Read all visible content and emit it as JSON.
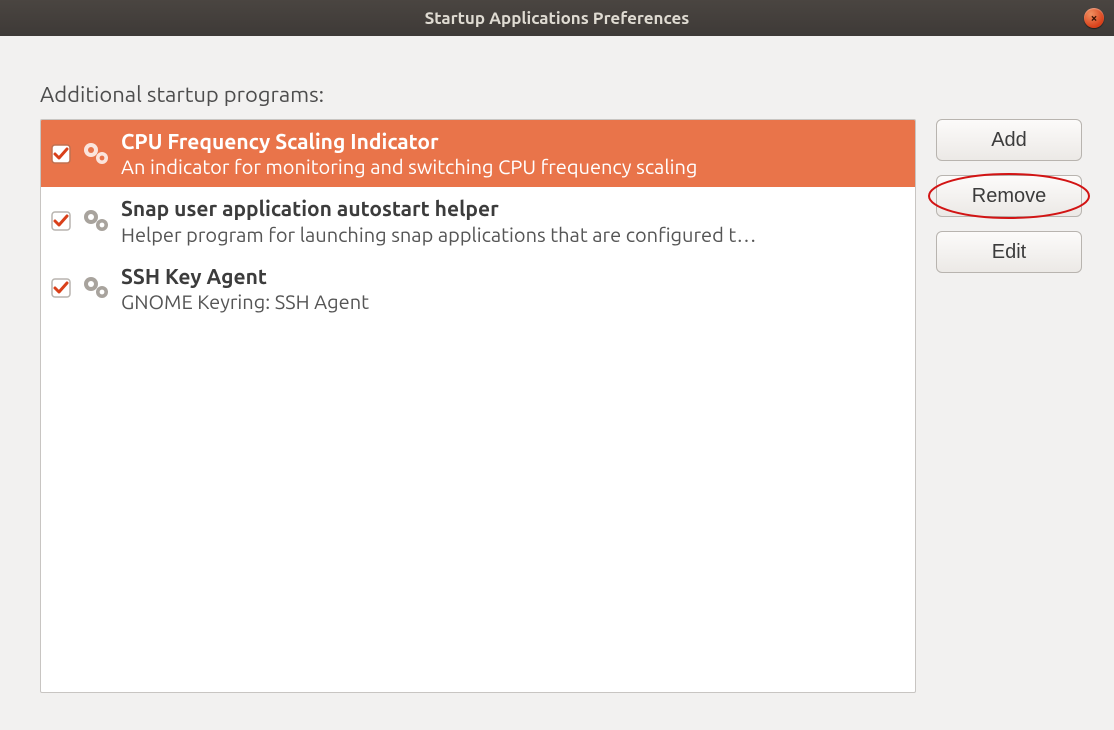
{
  "window": {
    "title": "Startup Applications Preferences"
  },
  "section_label": "Additional startup programs:",
  "buttons": {
    "add": "Add",
    "remove": "Remove",
    "edit": "Edit"
  },
  "colors": {
    "selection": "#e9744a",
    "titlebar": "#3e3a37",
    "close": "#d9401a"
  },
  "annotation": {
    "circled_button": "remove"
  },
  "items": [
    {
      "name": "CPU Frequency Scaling Indicator",
      "desc": "An indicator for monitoring and switching CPU frequency scaling",
      "checked": true,
      "selected": true
    },
    {
      "name": "Snap user application autostart helper",
      "desc": "Helper program for launching snap applications that are configured t…",
      "checked": true,
      "selected": false
    },
    {
      "name": "SSH Key Agent",
      "desc": "GNOME Keyring: SSH Agent",
      "checked": true,
      "selected": false
    }
  ]
}
